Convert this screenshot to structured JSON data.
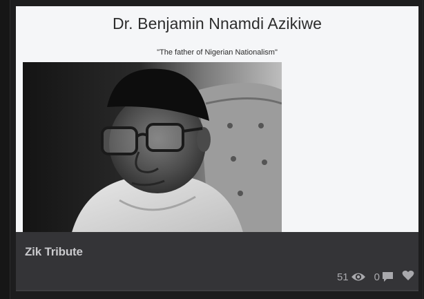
{
  "preview": {
    "title": "Dr. Benjamin Nnamdi Azikiwe",
    "subtitle": "\"The father of Nigerian Nationalism\""
  },
  "pen": {
    "title": "Zik Tribute"
  },
  "stats": {
    "views": "51",
    "comments": "0",
    "views_icon": "eye-icon",
    "comments_icon": "comment-icon",
    "like_icon": "heart-icon"
  },
  "colors": {
    "page_background": "#161616",
    "info_panel": "#343437",
    "preview_background": "#f5f6f8",
    "title_text": "#c9c9cc",
    "stats_text": "#a9a9ad"
  }
}
